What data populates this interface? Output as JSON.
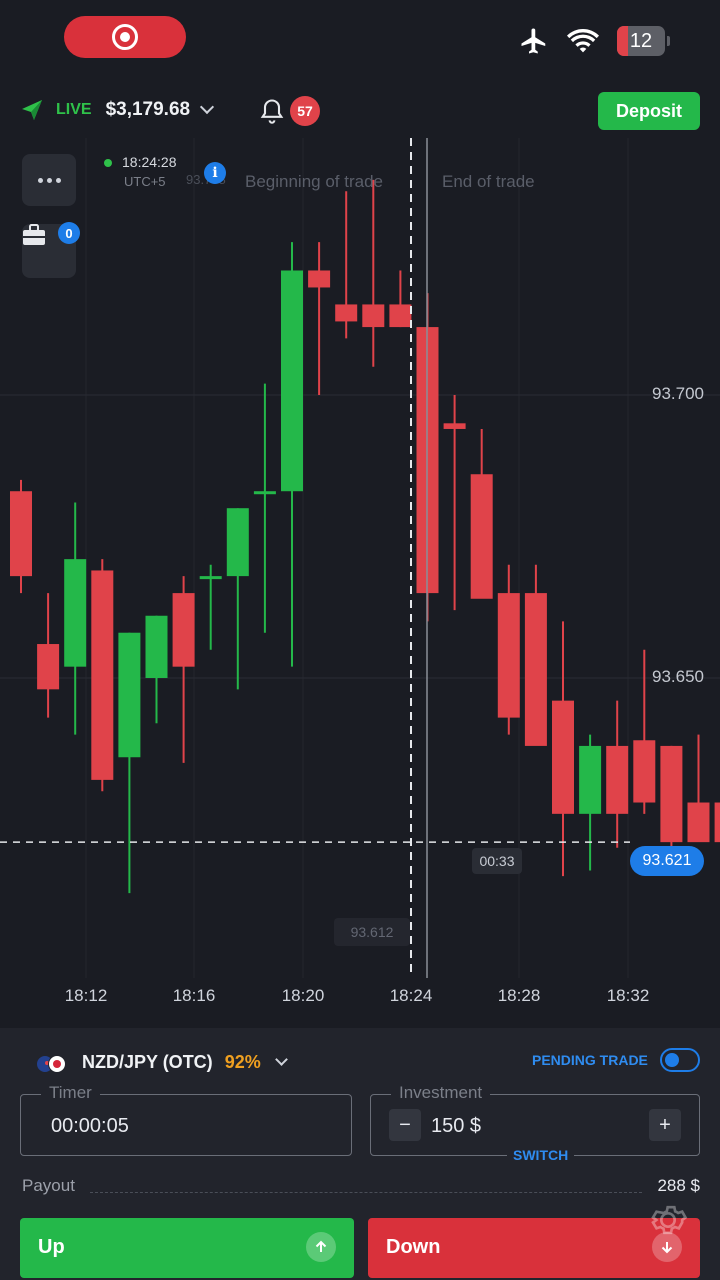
{
  "status_bar": {
    "battery": "12",
    "icons": [
      "record-icon",
      "airplane-icon",
      "wifi-icon",
      "battery-icon"
    ]
  },
  "account": {
    "mode": "LIVE",
    "balance": "$3,179.68",
    "notifications": "57",
    "deposit_label": "Deposit"
  },
  "chart": {
    "time": "18:24:28",
    "timezone": "UTC+5",
    "info_icon_glyph": "i",
    "ghost_price": "93.708",
    "begin_label": "Beginning of trade",
    "end_label": "End of trade",
    "price_labels": [
      "93.700",
      "93.650"
    ],
    "current_price": "93.621",
    "countdown": "00:33",
    "low_price": "93.612",
    "open_trades": "0",
    "colors": {
      "up": "#24b84a",
      "down": "#e0434a",
      "accent": "#1e7de8"
    },
    "chart_data": {
      "type": "candlestick",
      "x": [
        "18:11",
        "18:11:30",
        "18:12",
        "18:12:30",
        "18:13",
        "18:13:30",
        "18:14",
        "18:14:30",
        "18:15",
        "18:15:30",
        "18:16",
        "18:16:30",
        "18:17",
        "18:17:30",
        "18:18",
        "18:18:30",
        "18:19",
        "18:19:30",
        "18:20",
        "18:20:30",
        "18:21",
        "18:21:30",
        "18:22",
        "18:22:30",
        "18:23",
        "18:23:30",
        "18:24"
      ],
      "ohlc": [
        [
          93.683,
          93.685,
          93.665,
          93.668
        ],
        [
          93.656,
          93.665,
          93.643,
          93.648
        ],
        [
          93.652,
          93.681,
          93.64,
          93.671
        ],
        [
          93.669,
          93.671,
          93.63,
          93.632
        ],
        [
          93.636,
          93.658,
          93.612,
          93.658
        ],
        [
          93.65,
          93.661,
          93.642,
          93.661
        ],
        [
          93.665,
          93.668,
          93.635,
          93.652
        ],
        [
          93.668,
          93.67,
          93.655,
          93.668
        ],
        [
          93.668,
          93.68,
          93.648,
          93.68
        ],
        [
          93.683,
          93.702,
          93.658,
          93.683
        ],
        [
          93.683,
          93.727,
          93.652,
          93.722
        ],
        [
          93.722,
          93.727,
          93.7,
          93.719
        ],
        [
          93.716,
          93.736,
          93.71,
          93.713
        ],
        [
          93.716,
          93.738,
          93.705,
          93.712
        ],
        [
          93.716,
          93.722,
          93.712,
          93.712
        ],
        [
          93.712,
          93.718,
          93.66,
          93.665
        ],
        [
          93.695,
          93.7,
          93.662,
          93.694
        ],
        [
          93.686,
          93.694,
          93.675,
          93.664
        ],
        [
          93.665,
          93.67,
          93.64,
          93.643
        ],
        [
          93.665,
          93.67,
          93.64,
          93.638
        ],
        [
          93.646,
          93.66,
          93.615,
          93.626
        ],
        [
          93.626,
          93.64,
          93.616,
          93.638
        ],
        [
          93.638,
          93.646,
          93.62,
          93.626
        ],
        [
          93.639,
          93.655,
          93.626,
          93.628
        ],
        [
          93.638,
          93.638,
          93.617,
          93.621
        ],
        [
          93.628,
          93.64,
          93.623,
          93.621
        ],
        [
          93.628,
          93.631,
          93.612,
          93.621
        ]
      ],
      "x_ticks": [
        "18:12",
        "18:16",
        "18:20",
        "18:24",
        "18:28",
        "18:32"
      ],
      "y_ticks": [
        "93.700",
        "93.650"
      ],
      "ylim": [
        93.595,
        93.745
      ]
    }
  },
  "panel": {
    "asset": "NZD/JPY (OTC)",
    "payout_pct": "92%",
    "pending_label": "PENDING TRADE",
    "timer_label": "Timer",
    "timer_value": "00:00:05",
    "investment_label": "Investment",
    "investment_value": "150 $",
    "minus": "−",
    "plus": "+",
    "switch_label": "SWITCH",
    "payout_label": "Payout",
    "payout_value": "288 $",
    "up_label": "Up",
    "down_label": "Down"
  }
}
